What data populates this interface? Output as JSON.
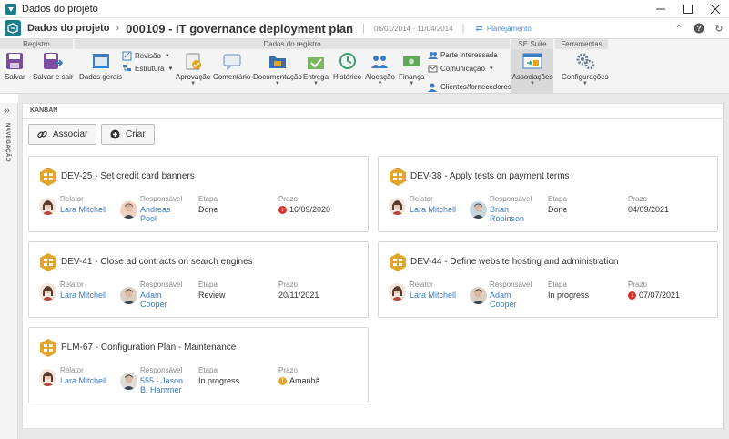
{
  "window": {
    "title": "Dados do projeto"
  },
  "header": {
    "section": "Dados do projeto",
    "project_title": "000109 - IT governance deployment plan",
    "dates": "06/01/2014 - 11/04/2014",
    "phase": "Planejamento"
  },
  "ribbon": {
    "groups": {
      "registro": "Registro",
      "dados": "Dados do registro",
      "suite": "SE Suite",
      "ferramentas": "Ferramentas"
    },
    "buttons": {
      "salvar": "Salvar",
      "salvar_sair": "Salvar e sair",
      "dados_gerais": "Dados gerais",
      "revisao": "Revisão",
      "estrutura": "Estrutura",
      "aprovacao": "Aprovação",
      "comentario": "Comentário",
      "documentacao": "Documentação",
      "entrega": "Entrega",
      "historico": "Histórico",
      "alocacao": "Alocação",
      "financa": "Finança",
      "parte_interessada": "Parte interessada",
      "comunicacao": "Comunicação",
      "clientes": "Clientes/fornecedores",
      "associacoes": "Associações",
      "configuracoes": "Configurações"
    }
  },
  "sidenav": {
    "label": "NAVEGAÇÃO"
  },
  "kanban": {
    "title": "KANBAN",
    "associar": "Associar",
    "criar": "Criar",
    "field_labels": {
      "relator": "Relator",
      "responsavel": "Responsável",
      "etapa": "Etapa",
      "prazo": "Prazo"
    },
    "cards": [
      {
        "id": "DEV-25",
        "title": "Set credit card banners",
        "reporter": "Lara Mitchell",
        "responsible_l1": "Andreas",
        "responsible_l2": "Pool",
        "stage": "Done",
        "due": "16/09/2020",
        "due_status": "overdue"
      },
      {
        "id": "DEV-38",
        "title": "Apply tests on payment terms",
        "reporter": "Lara Mitchell",
        "responsible_l1": "Brian",
        "responsible_l2": "Robinson",
        "stage": "Done",
        "due": "04/09/2021",
        "due_status": "none"
      },
      {
        "id": "DEV-41",
        "title": "Close ad contracts on search engines",
        "reporter": "Lara Mitchell",
        "responsible_l1": "Adam",
        "responsible_l2": "Cooper",
        "stage": "Review",
        "due": "20/11/2021",
        "due_status": "none"
      },
      {
        "id": "DEV-44",
        "title": "Define website hosting and administration",
        "reporter": "Lara Mitchell",
        "responsible_l1": "Adam",
        "responsible_l2": "Cooper",
        "stage": "In progress",
        "due": "07/07/2021",
        "due_status": "overdue"
      },
      {
        "id": "PLM-67",
        "title": "Configuration Plan - Maintenance",
        "reporter": "Lara Mitchell",
        "responsible_l1": "555 - Jason",
        "responsible_l2": "B. Hammer",
        "stage": "In progress",
        "due": "Amanhã",
        "due_status": "warning"
      }
    ]
  },
  "colors": {
    "link": "#3b7dc4",
    "brand": "#1b7c8c",
    "overdue": "#d9342b",
    "warning": "#e8a317",
    "kanban_icon": "#e0a52a"
  }
}
